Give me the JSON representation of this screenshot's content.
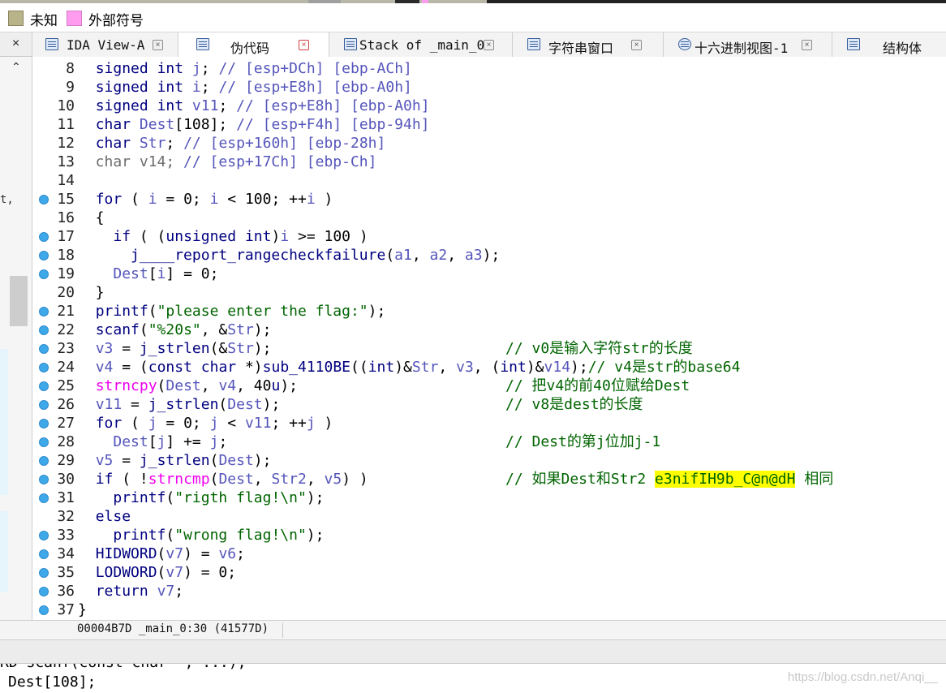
{
  "legend": {
    "items": [
      {
        "label": "未知",
        "color": "#b9b38a"
      },
      {
        "label": "外部符号",
        "color": "#ff9cf0"
      }
    ]
  },
  "tabs": [
    {
      "label": "IDA View-A",
      "active": false
    },
    {
      "label": "伪代码",
      "active": true
    },
    {
      "label": "Stack of _main_0",
      "active": false
    },
    {
      "label": "字符串窗口",
      "active": false
    },
    {
      "label": "十六进制视图-1",
      "active": false
    },
    {
      "label": "结构体",
      "active": false
    }
  ],
  "close_all_glyph": "×",
  "left_pane_fragment": "t,",
  "code": {
    "lines": [
      {
        "n": "8",
        "bp": false,
        "text": "  signed int j; // [esp+DCh] [ebp-ACh]"
      },
      {
        "n": "9",
        "bp": false,
        "text": "  signed int i; // [esp+E8h] [ebp-A0h]"
      },
      {
        "n": "10",
        "bp": false,
        "text": "  signed int v11; // [esp+E8h] [ebp-A0h]"
      },
      {
        "n": "11",
        "bp": false,
        "text": "  char Dest[108]; // [esp+F4h] [ebp-94h]"
      },
      {
        "n": "12",
        "bp": false,
        "text": "  char Str; // [esp+160h] [ebp-28h]"
      },
      {
        "n": "13",
        "bp": false,
        "text": "  char v14; // [esp+17Ch] [ebp-Ch]"
      },
      {
        "n": "14",
        "bp": false,
        "text": ""
      },
      {
        "n": "15",
        "bp": true,
        "text": "  for ( i = 0; i < 100; ++i )"
      },
      {
        "n": "16",
        "bp": false,
        "text": "  {"
      },
      {
        "n": "17",
        "bp": true,
        "text": "    if ( (unsigned int)i >= 100 )"
      },
      {
        "n": "18",
        "bp": true,
        "text": "      j____report_rangecheckfailure(a1, a2, a3);"
      },
      {
        "n": "19",
        "bp": true,
        "text": "    Dest[i] = 0;"
      },
      {
        "n": "20",
        "bp": false,
        "text": "  }"
      },
      {
        "n": "21",
        "bp": true,
        "text": "  printf(\"please enter the flag:\");"
      },
      {
        "n": "22",
        "bp": true,
        "text": "  scanf(\"%20s\", &Str);"
      },
      {
        "n": "23",
        "bp": true,
        "text": "  v3 = j_strlen(&Str);",
        "comment": "// v0是输入字符str的长度"
      },
      {
        "n": "24",
        "bp": true,
        "text": "  v4 = (const char *)sub_4110BE((int)&Str, v3, (int)&v14);// v4是str的base64"
      },
      {
        "n": "25",
        "bp": true,
        "text": "  strncpy(Dest, v4, 40u);",
        "comment": "// 把v4的前40位赋给Dest"
      },
      {
        "n": "26",
        "bp": true,
        "text": "  v11 = j_strlen(Dest);",
        "comment": "// v8是dest的长度"
      },
      {
        "n": "27",
        "bp": true,
        "text": "  for ( j = 0; j < v11; ++j )"
      },
      {
        "n": "28",
        "bp": true,
        "text": "    Dest[j] += j;",
        "comment": "// Dest的第j位加j-1"
      },
      {
        "n": "29",
        "bp": true,
        "text": "  v5 = j_strlen(Dest);"
      },
      {
        "n": "30",
        "bp": true,
        "text": "  if ( !strncmp(Dest, Str2, v5) )",
        "comment": "// 如果Dest和Str2 ",
        "highlight": "e3nifIH9b_C@n@dH",
        "comment_tail": " 相同"
      },
      {
        "n": "31",
        "bp": true,
        "text": "    printf(\"rigth flag!\\n\");"
      },
      {
        "n": "32",
        "bp": false,
        "text": "  else"
      },
      {
        "n": "33",
        "bp": true,
        "text": "    printf(\"wrong flag!\\n\");"
      },
      {
        "n": "34",
        "bp": true,
        "text": "  HIDWORD(v7) = v6;"
      },
      {
        "n": "35",
        "bp": true,
        "text": "  LODWORD(v7) = 0;"
      },
      {
        "n": "36",
        "bp": true,
        "text": "  return v7;"
      },
      {
        "n": "37",
        "bp": true,
        "text": "}"
      }
    ]
  },
  "status": {
    "location": "00004B7D _main_0:30 (41577D)"
  },
  "output": {
    "line1": "RD scanf(const char *, ...);",
    "line2": "Dest[108];"
  },
  "watermark": "https://blog.csdn.net/Anqi__",
  "colors": {
    "keyword": "#000080",
    "variable": "#5555bb",
    "string": "#006400",
    "comment": "#006400",
    "function_pink": "#ee00ee",
    "highlight": "#ffff00",
    "breakpoint": "#3fa8e8"
  }
}
